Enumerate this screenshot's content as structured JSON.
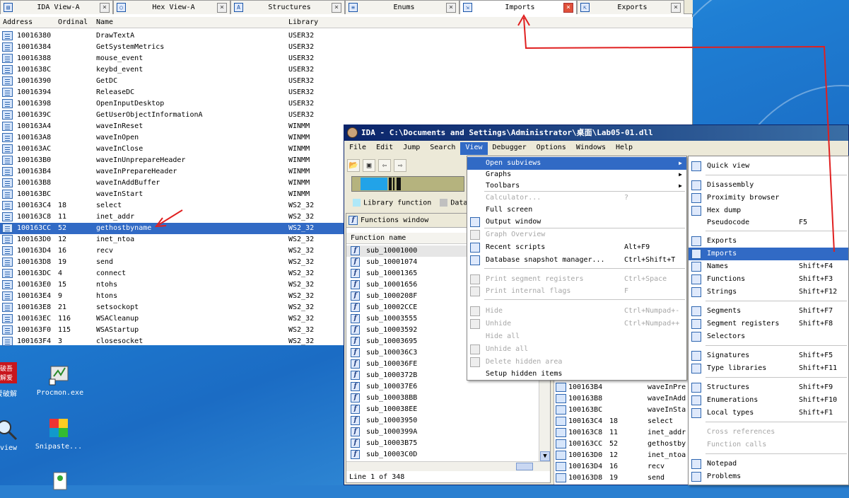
{
  "tabs": [
    {
      "label": "IDA View-A",
      "icon": "disassembly-icon",
      "active": false
    },
    {
      "label": "Hex View-A",
      "icon": "hex-icon",
      "active": false
    },
    {
      "label": "Structures",
      "icon": "structures-icon",
      "active": false
    },
    {
      "label": "Enums",
      "icon": "enums-icon",
      "active": false
    },
    {
      "label": "Imports",
      "icon": "imports-icon",
      "active": true
    },
    {
      "label": "Exports",
      "icon": "exports-icon",
      "active": false
    }
  ],
  "imports_table": {
    "headers": {
      "address": "Address",
      "ordinal": "Ordinal",
      "name": "Name",
      "library": "Library"
    },
    "rows": [
      {
        "address": "10016380",
        "ordinal": "",
        "name": "DrawTextA",
        "library": "USER32"
      },
      {
        "address": "10016384",
        "ordinal": "",
        "name": "GetSystemMetrics",
        "library": "USER32"
      },
      {
        "address": "10016388",
        "ordinal": "",
        "name": "mouse_event",
        "library": "USER32"
      },
      {
        "address": "1001638C",
        "ordinal": "",
        "name": "keybd_event",
        "library": "USER32"
      },
      {
        "address": "10016390",
        "ordinal": "",
        "name": "GetDC",
        "library": "USER32"
      },
      {
        "address": "10016394",
        "ordinal": "",
        "name": "ReleaseDC",
        "library": "USER32"
      },
      {
        "address": "10016398",
        "ordinal": "",
        "name": "OpenInputDesktop",
        "library": "USER32"
      },
      {
        "address": "1001639C",
        "ordinal": "",
        "name": "GetUserObjectInformationA",
        "library": "USER32"
      },
      {
        "address": "100163A4",
        "ordinal": "",
        "name": "waveInReset",
        "library": "WINMM"
      },
      {
        "address": "100163A8",
        "ordinal": "",
        "name": "waveInOpen",
        "library": "WINMM"
      },
      {
        "address": "100163AC",
        "ordinal": "",
        "name": "waveInClose",
        "library": "WINMM"
      },
      {
        "address": "100163B0",
        "ordinal": "",
        "name": "waveInUnprepareHeader",
        "library": "WINMM"
      },
      {
        "address": "100163B4",
        "ordinal": "",
        "name": "waveInPrepareHeader",
        "library": "WINMM"
      },
      {
        "address": "100163B8",
        "ordinal": "",
        "name": "waveInAddBuffer",
        "library": "WINMM"
      },
      {
        "address": "100163BC",
        "ordinal": "",
        "name": "waveInStart",
        "library": "WINMM"
      },
      {
        "address": "100163C4",
        "ordinal": "18",
        "name": "select",
        "library": "WS2_32"
      },
      {
        "address": "100163C8",
        "ordinal": "11",
        "name": "inet_addr",
        "library": "WS2_32"
      },
      {
        "address": "100163CC",
        "ordinal": "52",
        "name": "gethostbyname",
        "library": "WS2_32"
      },
      {
        "address": "100163D0",
        "ordinal": "12",
        "name": "inet_ntoa",
        "library": "WS2_32"
      },
      {
        "address": "100163D4",
        "ordinal": "16",
        "name": "recv",
        "library": "WS2_32"
      },
      {
        "address": "100163D8",
        "ordinal": "19",
        "name": "send",
        "library": "WS2_32"
      },
      {
        "address": "100163DC",
        "ordinal": "4",
        "name": "connect",
        "library": "WS2_32"
      },
      {
        "address": "100163E0",
        "ordinal": "15",
        "name": "ntohs",
        "library": "WS2_32"
      },
      {
        "address": "100163E4",
        "ordinal": "9",
        "name": "htons",
        "library": "WS2_32"
      },
      {
        "address": "100163E8",
        "ordinal": "21",
        "name": "setsockopt",
        "library": "WS2_32"
      },
      {
        "address": "100163EC",
        "ordinal": "116",
        "name": "WSACleanup",
        "library": "WS2_32"
      },
      {
        "address": "100163F0",
        "ordinal": "115",
        "name": "WSAStartup",
        "library": "WS2_32"
      },
      {
        "address": "100163F4",
        "ordinal": "3",
        "name": "closesocket",
        "library": "WS2_32"
      }
    ],
    "selected_index": 17
  },
  "desktop_icons": [
    {
      "label": "爱破解",
      "icon": "crack-tool-icon"
    },
    {
      "label": "Procmon.exe",
      "icon": "procmon-icon"
    },
    {
      "label": "rview",
      "icon": "magnifier-icon"
    },
    {
      "label": "Snipaste...",
      "icon": "snipaste-icon"
    }
  ],
  "ida_window": {
    "title": "IDA - C:\\Documents and Settings\\Administrator\\桌面\\Lab05-01.dll",
    "menubar": [
      "File",
      "Edit",
      "Jump",
      "Search",
      "View",
      "Debugger",
      "Options",
      "Windows",
      "Help"
    ],
    "legend": [
      "Library function",
      "Data"
    ],
    "functions_window": {
      "title": "Functions window",
      "header": "Function name",
      "items": [
        "sub_10001000",
        "sub_10001074",
        "sub_10001365",
        "sub_10001656",
        "sub_1000208F",
        "sub_10002CCE",
        "sub_10003555",
        "sub_10003592",
        "sub_10003695",
        "sub_100036C3",
        "sub_100036FE",
        "sub_1000372B",
        "sub_100037E6",
        "sub_100038BB",
        "sub_100038EE",
        "sub_10003950",
        "sub_1000399A",
        "sub_10003B75",
        "sub_10003C0D"
      ],
      "status": "Line 1 of 348"
    },
    "inner_imports": [
      {
        "address": "100163B4",
        "ordinal": "",
        "name": "waveInPre"
      },
      {
        "address": "100163B8",
        "ordinal": "",
        "name": "waveInAdd"
      },
      {
        "address": "100163BC",
        "ordinal": "",
        "name": "waveInSta"
      },
      {
        "address": "100163C4",
        "ordinal": "18",
        "name": "select"
      },
      {
        "address": "100163C8",
        "ordinal": "11",
        "name": "inet_addr"
      },
      {
        "address": "100163CC",
        "ordinal": "52",
        "name": "gethostby"
      },
      {
        "address": "100163D0",
        "ordinal": "12",
        "name": "inet_ntoa"
      },
      {
        "address": "100163D4",
        "ordinal": "16",
        "name": "recv"
      },
      {
        "address": "100163D8",
        "ordinal": "19",
        "name": "send"
      }
    ]
  },
  "view_menu": {
    "items": [
      {
        "label": "Open subviews",
        "shortcut": "",
        "submenu": true,
        "highlighted": true,
        "disabled": false,
        "icon": ""
      },
      {
        "label": "Graphs",
        "shortcut": "",
        "submenu": true,
        "disabled": false,
        "icon": ""
      },
      {
        "label": "Toolbars",
        "shortcut": "",
        "submenu": true,
        "disabled": false,
        "icon": ""
      },
      {
        "label": "Calculator...",
        "shortcut": "?",
        "disabled": true,
        "icon": ""
      },
      {
        "label": "Full screen",
        "shortcut": "",
        "disabled": false,
        "icon": ""
      },
      {
        "label": "Output window",
        "shortcut": "",
        "disabled": false,
        "icon": "output-window-icon"
      },
      {
        "label": "Graph Overview",
        "shortcut": "",
        "disabled": true,
        "icon": "graph-overview-icon"
      },
      {
        "label": "Recent scripts",
        "shortcut": "Alt+F9",
        "disabled": false,
        "icon": "script-icon"
      },
      {
        "label": "Database snapshot manager...",
        "shortcut": "Ctrl+Shift+T",
        "disabled": false,
        "icon": "snapshot-icon"
      },
      {
        "label": "Print segment registers",
        "shortcut": "Ctrl+Space",
        "disabled": true,
        "icon": "print-segment-icon"
      },
      {
        "label": "Print internal flags",
        "shortcut": "F",
        "disabled": true,
        "icon": "info-icon"
      },
      {
        "label": "Hide",
        "shortcut": "Ctrl+Numpad+-",
        "disabled": true,
        "icon": "hide-icon"
      },
      {
        "label": "Unhide",
        "shortcut": "Ctrl+Numpad++",
        "disabled": true,
        "icon": "unhide-icon"
      },
      {
        "label": "Hide all",
        "shortcut": "",
        "disabled": true,
        "icon": ""
      },
      {
        "label": "Unhide all",
        "shortcut": "",
        "disabled": true,
        "icon": "unhide-all-icon"
      },
      {
        "label": "Delete hidden area",
        "shortcut": "",
        "disabled": true,
        "icon": "delete-icon"
      },
      {
        "label": "Setup hidden items",
        "shortcut": "",
        "disabled": false,
        "icon": ""
      }
    ]
  },
  "subviews_menu": {
    "items": [
      {
        "label": "Quick view",
        "shortcut": "",
        "icon": "quick-view-icon",
        "disabled": false
      },
      {
        "label": "Disassembly",
        "shortcut": "",
        "icon": "disassembly-icon",
        "disabled": false
      },
      {
        "label": "Proximity browser",
        "shortcut": "",
        "icon": "proximity-icon",
        "disabled": false
      },
      {
        "label": "Hex dump",
        "shortcut": "",
        "icon": "hex-icon",
        "disabled": false
      },
      {
        "label": "Pseudocode",
        "shortcut": "F5",
        "icon": "",
        "disabled": false
      },
      {
        "label": "Exports",
        "shortcut": "",
        "icon": "exports-icon",
        "disabled": false
      },
      {
        "label": "Imports",
        "shortcut": "",
        "icon": "imports-icon",
        "disabled": false,
        "highlighted": true
      },
      {
        "label": "Names",
        "shortcut": "Shift+F4",
        "icon": "names-icon",
        "disabled": false
      },
      {
        "label": "Functions",
        "shortcut": "Shift+F3",
        "icon": "functions-icon",
        "disabled": false
      },
      {
        "label": "Strings",
        "shortcut": "Shift+F12",
        "icon": "strings-icon",
        "disabled": false
      },
      {
        "label": "Segments",
        "shortcut": "Shift+F7",
        "icon": "segments-icon",
        "disabled": false
      },
      {
        "label": "Segment registers",
        "shortcut": "Shift+F8",
        "icon": "segment-registers-icon",
        "disabled": false
      },
      {
        "label": "Selectors",
        "shortcut": "",
        "icon": "selectors-icon",
        "disabled": false
      },
      {
        "label": "Signatures",
        "shortcut": "Shift+F5",
        "icon": "signatures-icon",
        "disabled": false
      },
      {
        "label": "Type libraries",
        "shortcut": "Shift+F11",
        "icon": "type-libraries-icon",
        "disabled": false
      },
      {
        "label": "Structures",
        "shortcut": "Shift+F9",
        "icon": "structures-icon",
        "disabled": false
      },
      {
        "label": "Enumerations",
        "shortcut": "Shift+F10",
        "icon": "enums-icon",
        "disabled": false
      },
      {
        "label": "Local types",
        "shortcut": "Shift+F1",
        "icon": "local-types-icon",
        "disabled": false
      },
      {
        "label": "Cross references",
        "shortcut": "",
        "icon": "",
        "disabled": true
      },
      {
        "label": "Function calls",
        "shortcut": "",
        "icon": "",
        "disabled": true
      },
      {
        "label": "Notepad",
        "shortcut": "",
        "icon": "notepad-icon",
        "disabled": false
      },
      {
        "label": "Problems",
        "shortcut": "",
        "icon": "problems-icon",
        "disabled": false
      }
    ]
  },
  "colors": {
    "selection": "#316ac5",
    "titlebar": "#0a246a",
    "annotation": "#e02020"
  }
}
